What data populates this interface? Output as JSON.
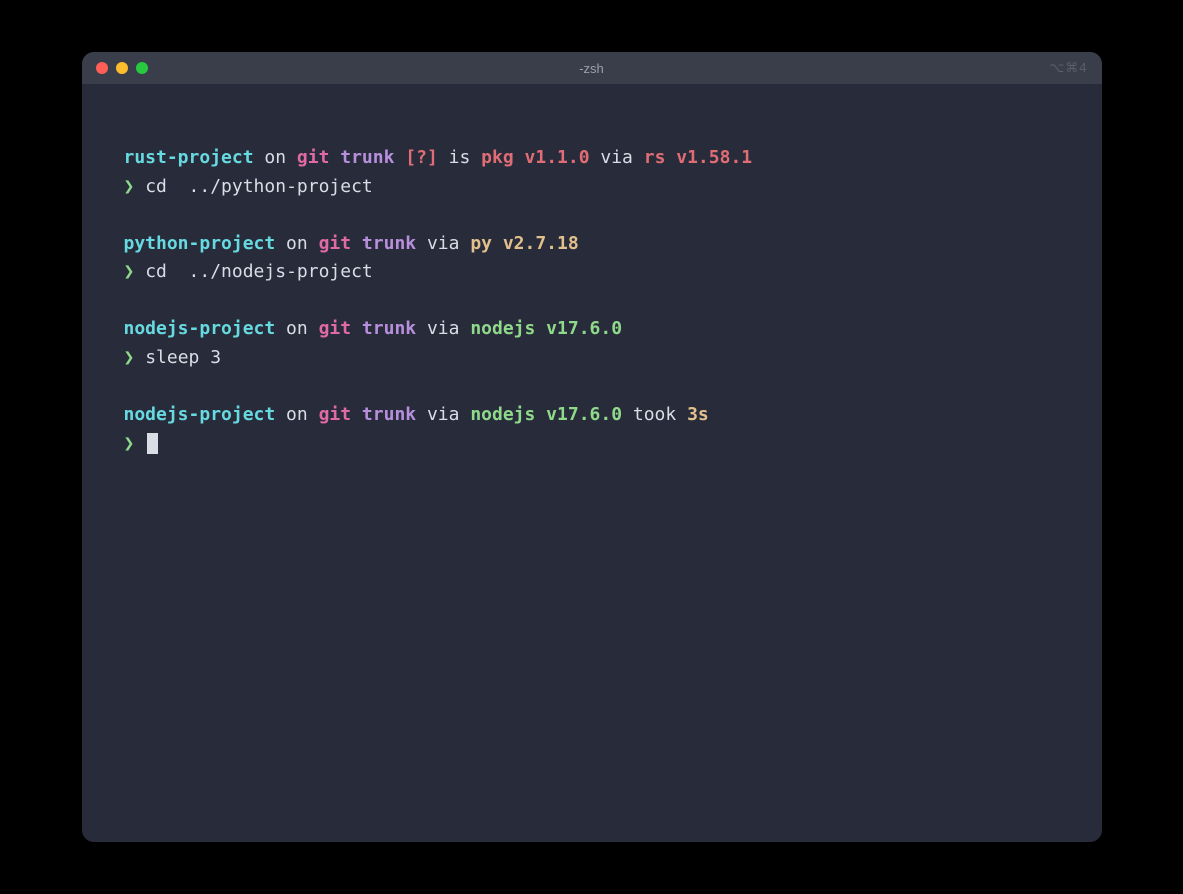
{
  "window": {
    "title": "-zsh",
    "right_indicator": "⌥⌘4"
  },
  "blocks": [
    {
      "prompt": {
        "dir": "rust-project",
        "on": " on ",
        "vcs": "git",
        "branch": " trunk",
        "status": " [?]",
        "is": " is ",
        "pkg_label": "pkg",
        "pkg_version": " v1.1.0",
        "via": " via ",
        "rt_label": "rs",
        "rt_version": " v1.58.1",
        "took_label": "",
        "took_value": ""
      },
      "command": "cd  ../python-project"
    },
    {
      "prompt": {
        "dir": "python-project",
        "on": " on ",
        "vcs": "git",
        "branch": " trunk",
        "status": "",
        "is": "",
        "pkg_label": "",
        "pkg_version": "",
        "via": " via ",
        "rt_label": "py",
        "rt_version": " v2.7.18",
        "took_label": "",
        "took_value": ""
      },
      "command": "cd  ../nodejs-project"
    },
    {
      "prompt": {
        "dir": "nodejs-project",
        "on": " on ",
        "vcs": "git",
        "branch": " trunk",
        "status": "",
        "is": "",
        "pkg_label": "",
        "pkg_version": "",
        "via": " via ",
        "rt_label": "nodejs",
        "rt_version": " v17.6.0",
        "took_label": "",
        "took_value": ""
      },
      "command": "sleep 3"
    },
    {
      "prompt": {
        "dir": "nodejs-project",
        "on": " on ",
        "vcs": "git",
        "branch": " trunk",
        "status": "",
        "is": "",
        "pkg_label": "",
        "pkg_version": "",
        "via": " via ",
        "rt_label": "nodejs",
        "rt_version": " v17.6.0",
        "took_label": " took ",
        "took_value": "3s"
      },
      "command": ""
    }
  ],
  "prompt_char": "❯ "
}
